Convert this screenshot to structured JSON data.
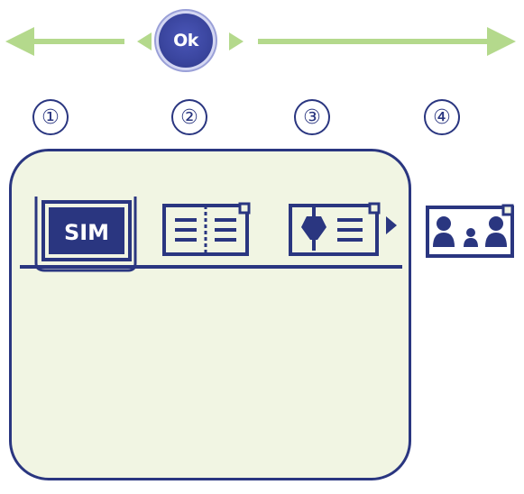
{
  "ok_button": {
    "label": "Ok"
  },
  "steps": [
    "①",
    "②",
    "③",
    "④"
  ],
  "tabs": [
    {
      "icon": "sim-card-icon",
      "label": "SIM",
      "selected": true
    },
    {
      "icon": "phonebook-icon",
      "selected": false
    },
    {
      "icon": "voice-memo-icon",
      "selected": false
    },
    {
      "icon": "contact-groups-icon",
      "selected": false
    }
  ],
  "colors": {
    "ink": "#2a3680",
    "arrow": "#b4d98c",
    "screen_bg": "#f1f5e3",
    "ok_button": "#3a459e"
  }
}
